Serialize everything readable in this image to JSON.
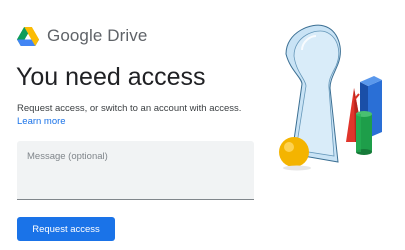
{
  "brand": {
    "name": "Google Drive",
    "icon": "google-drive-logo"
  },
  "heading": "You need access",
  "description": "Request access, or switch to an account with access.",
  "learn_more": "Learn more",
  "message": {
    "placeholder": "Message (optional)",
    "value": ""
  },
  "request_button": "Request access",
  "illustration": {
    "icon": "keyhole-illustration"
  },
  "colors": {
    "primary": "#1a73e8",
    "text": "#202124",
    "secondary_text": "#5f6368",
    "field_background": "#f1f3f4"
  }
}
